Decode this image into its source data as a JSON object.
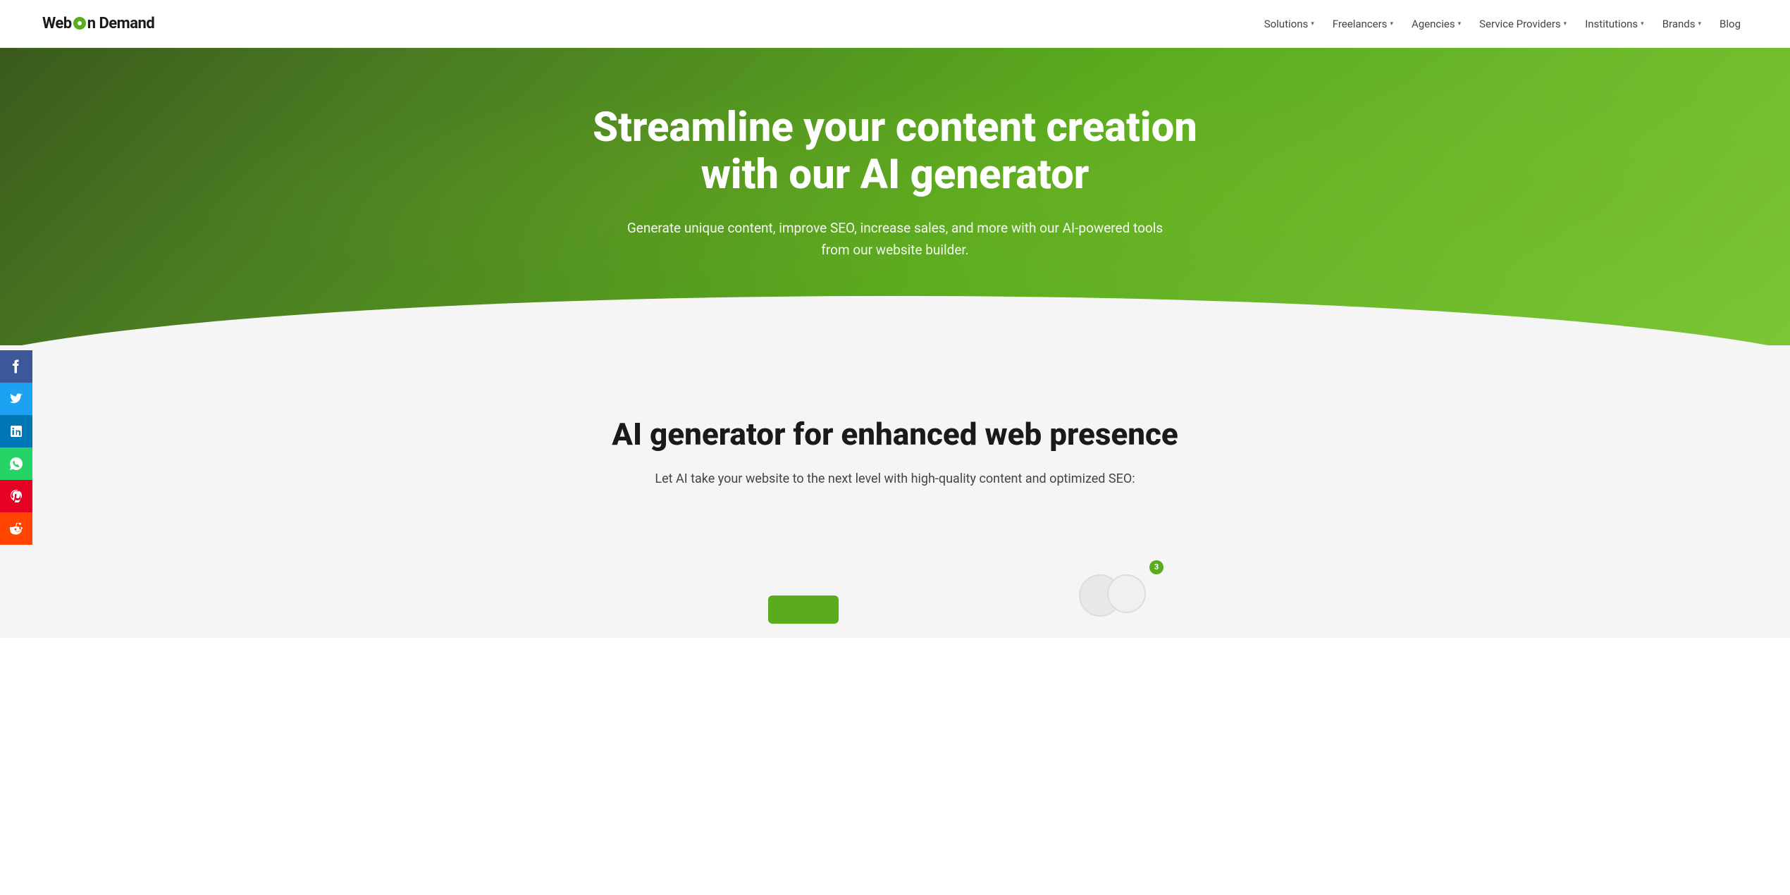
{
  "header": {
    "logo": {
      "text_before": "Web ",
      "text_after": "n Demand",
      "icon_label": "On"
    },
    "nav": {
      "items": [
        {
          "label": "Solutions",
          "has_dropdown": true
        },
        {
          "label": "Freelancers",
          "has_dropdown": true
        },
        {
          "label": "Agencies",
          "has_dropdown": true
        },
        {
          "label": "Service Providers",
          "has_dropdown": true
        },
        {
          "label": "Institutions",
          "has_dropdown": true
        },
        {
          "label": "Brands",
          "has_dropdown": true
        },
        {
          "label": "Blog",
          "has_dropdown": false
        }
      ]
    }
  },
  "hero": {
    "title": "Streamline your content creation with our AI generator",
    "subtitle": "Generate unique content, improve SEO, increase sales, and more with our AI-powered tools from our website builder."
  },
  "social": {
    "items": [
      {
        "name": "facebook",
        "icon": "f",
        "color": "#3b5998"
      },
      {
        "name": "twitter",
        "icon": "𝕏",
        "color": "#1da1f2"
      },
      {
        "name": "linkedin",
        "icon": "in",
        "color": "#0077b5"
      },
      {
        "name": "whatsapp",
        "icon": "✓",
        "color": "#25d366"
      },
      {
        "name": "pinterest",
        "icon": "P",
        "color": "#e60023"
      },
      {
        "name": "reddit",
        "icon": "r/",
        "color": "#ff4500"
      }
    ]
  },
  "content_section": {
    "title": "AI generator for enhanced web presence",
    "subtitle": "Let AI take your website to the next level with high-quality content and optimized SEO:"
  },
  "notification": {
    "badge_count": "3"
  }
}
